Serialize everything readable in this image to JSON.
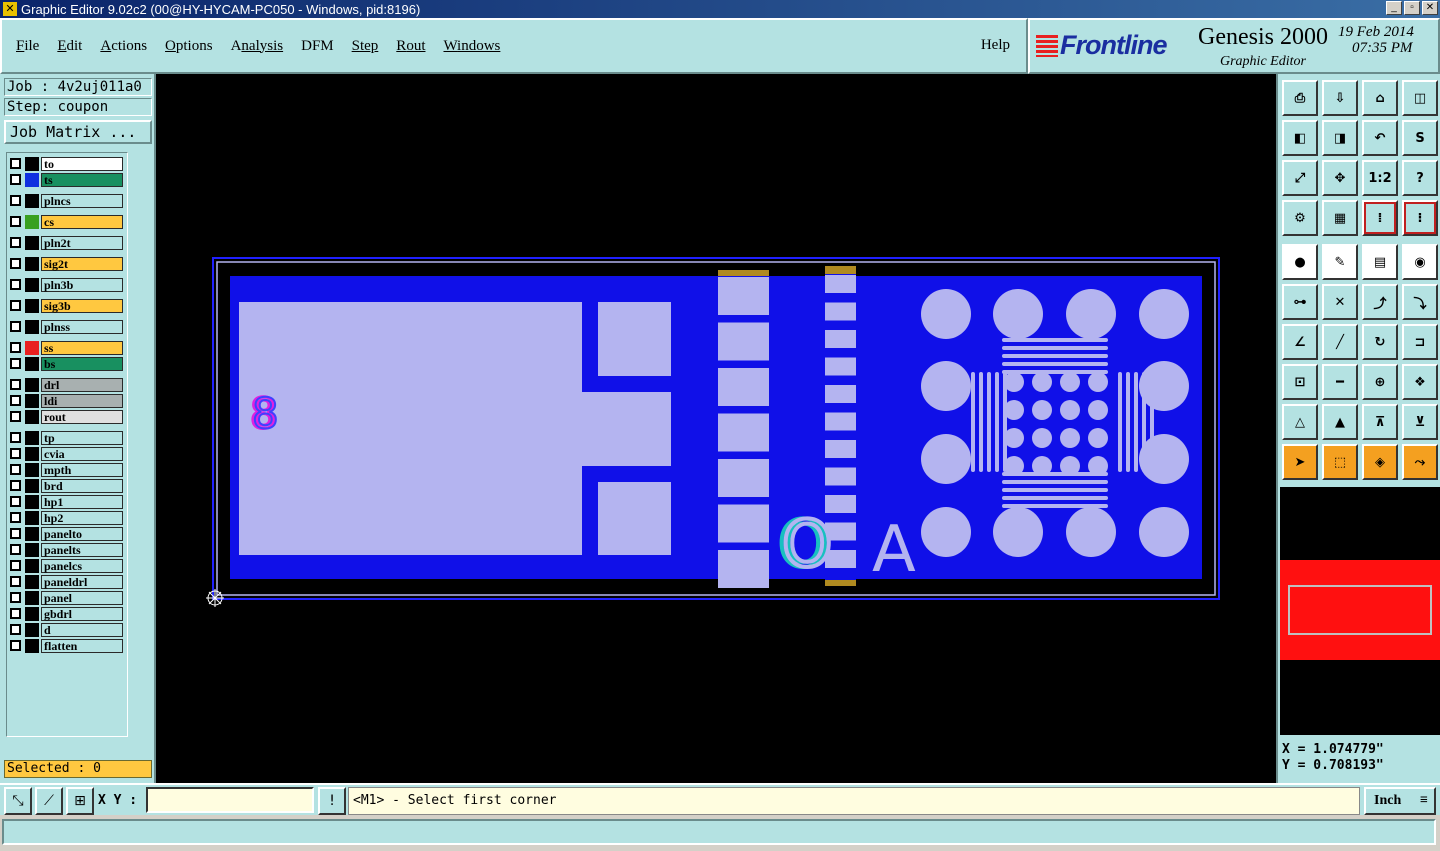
{
  "window": {
    "title": "Graphic Editor 9.02c2 (00@HY-HYCAM-PC050 - Windows, pid:8196)"
  },
  "menu": {
    "items": [
      {
        "u": "F",
        "rest": "ile"
      },
      {
        "u": "E",
        "rest": "dit"
      },
      {
        "u": "A",
        "rest": "ctions"
      },
      {
        "u": "O",
        "rest": "ptions"
      },
      {
        "u": "A",
        "rest": "nalysis"
      },
      {
        "u": "D",
        "rest": "FM"
      },
      {
        "u": "S",
        "rest": "tep"
      },
      {
        "u": "R",
        "rest": "out"
      },
      {
        "u": "W",
        "rest": "indows"
      }
    ],
    "help": "Help"
  },
  "brand": {
    "logo": "Frontline",
    "product": "Genesis 2000",
    "subtitle": "Graphic Editor",
    "date": "19 Feb 2014",
    "time": "07:35 PM"
  },
  "job": {
    "job_line": "Job : 4v2uj011a0",
    "step_line": "Step: coupon",
    "matrix_button": "Job Matrix ..."
  },
  "layers": [
    {
      "name": "to",
      "swatch": "#000000",
      "bg": "#ffffff"
    },
    {
      "name": "ts",
      "swatch": "#1030e0",
      "bg": "#189060"
    },
    {
      "name": "plncs",
      "swatch": "#000000",
      "bg": "#b4e2e2"
    },
    {
      "name": "cs",
      "swatch": "#38a020",
      "bg": "#ffc840"
    },
    {
      "name": "pln2t",
      "swatch": "#000000",
      "bg": "#b4e2e2"
    },
    {
      "name": "sig2t",
      "swatch": "#000000",
      "bg": "#ffc840"
    },
    {
      "name": "pln3b",
      "swatch": "#000000",
      "bg": "#b4e2e2"
    },
    {
      "name": "sig3b",
      "swatch": "#000000",
      "bg": "#ffc840"
    },
    {
      "name": "plnss",
      "swatch": "#000000",
      "bg": "#b4e2e2"
    },
    {
      "name": "ss",
      "swatch": "#e82020",
      "bg": "#ffc840"
    },
    {
      "name": "bs",
      "swatch": "#000000",
      "bg": "#189060"
    },
    {
      "name": "drl",
      "swatch": "#000000",
      "bg": "#a8b0b0"
    },
    {
      "name": "ldi",
      "swatch": "#000000",
      "bg": "#a8b0b0"
    },
    {
      "name": "rout",
      "swatch": "#000000",
      "bg": "#e0e0e0"
    },
    {
      "name": "tp",
      "swatch": "#000000",
      "bg": "#b4e2e2"
    },
    {
      "name": "cvia",
      "swatch": "#000000",
      "bg": "#b4e2e2"
    },
    {
      "name": "mpth",
      "swatch": "#000000",
      "bg": "#b4e2e2"
    },
    {
      "name": "brd",
      "swatch": "#000000",
      "bg": "#b4e2e2"
    },
    {
      "name": "hp1",
      "swatch": "#000000",
      "bg": "#b4e2e2"
    },
    {
      "name": "hp2",
      "swatch": "#000000",
      "bg": "#b4e2e2"
    },
    {
      "name": "panelto",
      "swatch": "#000000",
      "bg": "#b4e2e2"
    },
    {
      "name": "panelts",
      "swatch": "#000000",
      "bg": "#b4e2e2"
    },
    {
      "name": "panelcs",
      "swatch": "#000000",
      "bg": "#b4e2e2"
    },
    {
      "name": "paneldrl",
      "swatch": "#000000",
      "bg": "#b4e2e2"
    },
    {
      "name": "panel",
      "swatch": "#000000",
      "bg": "#b4e2e2"
    },
    {
      "name": "gbdrl",
      "swatch": "#000000",
      "bg": "#b4e2e2"
    },
    {
      "name": "d",
      "swatch": "#000000",
      "bg": "#b4e2e2"
    },
    {
      "name": "flatten",
      "swatch": "#000000",
      "bg": "#b4e2e2"
    }
  ],
  "selected": "Selected : 0",
  "canvas_text": {
    "glyph_b": "8",
    "glyph_o": "O",
    "glyph_a": "A"
  },
  "coords": {
    "x": "X = 1.074779\"",
    "y": "Y = 0.708193\""
  },
  "toolbar": {
    "labels": {
      "ratio": "1:2",
      "help": "?"
    }
  },
  "status": {
    "xy_label": "X Y :",
    "xy_value": "",
    "prompt": "<M1> - Select first corner",
    "unit": "Inch",
    "message": ""
  },
  "colors": {
    "panel": "#b4e2e2",
    "board_blue": "#1010e8",
    "pad": "#b4b4f0",
    "gold": "#b08a20",
    "selected_bg": "#ffc840"
  }
}
